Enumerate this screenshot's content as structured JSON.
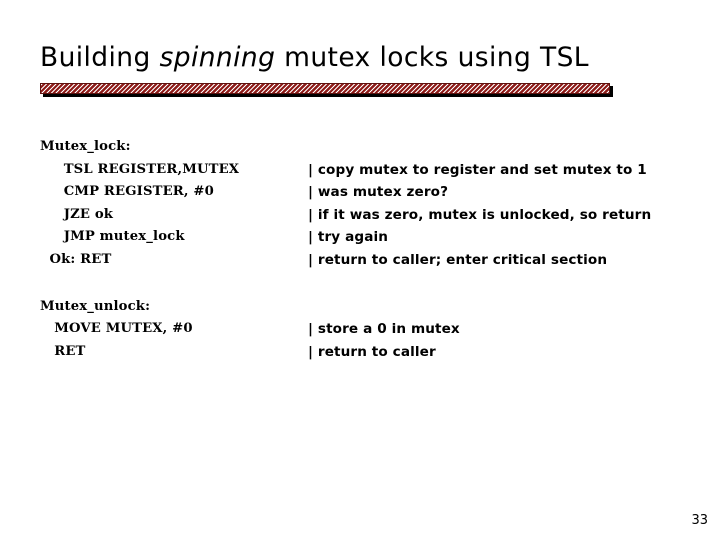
{
  "slide": {
    "title_parts": [
      {
        "text": "Building ",
        "style": "normal"
      },
      {
        "text": "spinning",
        "style": "italic"
      },
      {
        "text": " mutex locks using TSL",
        "style": "normal"
      }
    ],
    "title_plain": "Building spinning mutex locks using TSL",
    "page_number": "33",
    "accent_color": "#8e1b18",
    "rule_shadow_color": "#000000",
    "background_color": "#ffffff",
    "text_color": "#000000"
  },
  "code_blocks": [
    {
      "name": "mutex-lock-routine",
      "lines": [
        {
          "code": "Mutex_lock:",
          "comment": ""
        },
        {
          "code": "     TSL REGISTER,MUTEX",
          "comment": "| copy mutex to register and set mutex to 1"
        },
        {
          "code": "     CMP REGISTER, #0",
          "comment": "| was mutex zero?"
        },
        {
          "code": "     JZE ok",
          "comment": "| if it was zero, mutex is unlocked, so return"
        },
        {
          "code": "     JMP mutex_lock",
          "comment": "| try again"
        },
        {
          "code": "  Ok: RET",
          "comment": "| return to caller; enter critical section"
        }
      ]
    },
    {
      "name": "mutex-unlock-routine",
      "lines": [
        {
          "code": "Mutex_unlock:",
          "comment": ""
        },
        {
          "code": "   MOVE MUTEX, #0",
          "comment": "| store a 0 in mutex"
        },
        {
          "code": "   RET",
          "comment": "| return to caller"
        }
      ]
    }
  ]
}
